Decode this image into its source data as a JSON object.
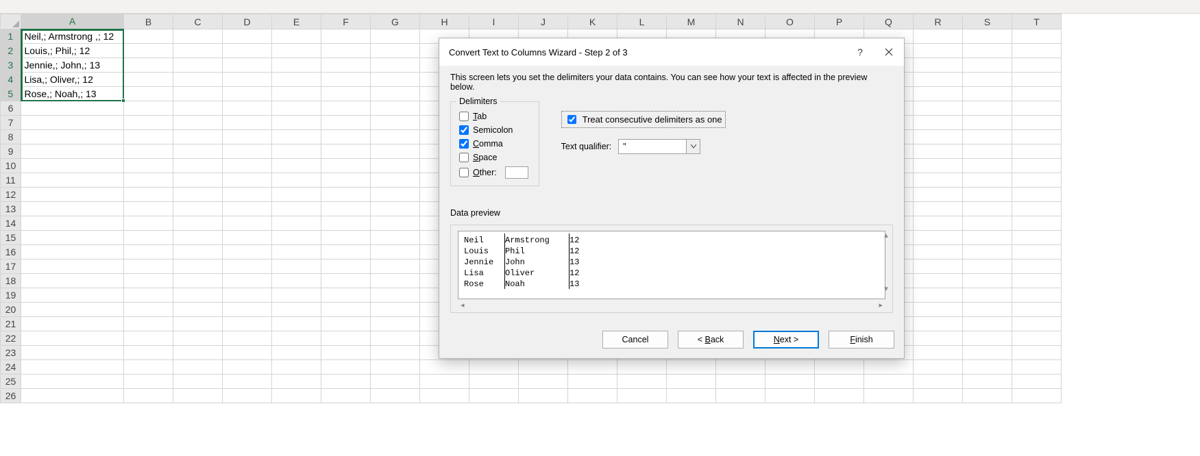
{
  "sheet": {
    "columns": [
      "A",
      "B",
      "C",
      "D",
      "E",
      "F",
      "G",
      "H",
      "I",
      "J",
      "K",
      "L",
      "M",
      "N",
      "O",
      "P",
      "Q",
      "R",
      "S",
      "T"
    ],
    "row_count": 26,
    "selected_col_index": 0,
    "selected_row_start": 1,
    "selected_row_end": 5,
    "cells": {
      "A1": "Neil,; Armstrong ,; 12",
      "A2": "Louis,; Phil,; 12",
      "A3": "Jennie,; John,; 13",
      "A4": "Lisa,; Oliver,; 12",
      "A5": "Rose,; Noah,; 13"
    }
  },
  "dialog": {
    "title": "Convert Text to Columns Wizard - Step 2 of 3",
    "description": "This screen lets you set the delimiters your data contains.  You can see how your text is affected in the preview below.",
    "delimiters_legend": "Delimiters",
    "tab_label": "Tab",
    "semicolon_label": "Semicolon",
    "comma_label": "Comma",
    "space_label": "Space",
    "other_label": "Other:",
    "tab_checked": false,
    "semicolon_checked": true,
    "comma_checked": true,
    "space_checked": false,
    "other_checked": false,
    "other_value": "",
    "treat_label": "Treat consecutive delimiters as one",
    "treat_checked": true,
    "qualifier_label": "Text qualifier:",
    "qualifier_value": "\"",
    "preview_label": "Data preview",
    "preview_rows": [
      [
        "Neil",
        "Armstrong",
        "12"
      ],
      [
        "Louis",
        "Phil",
        "12"
      ],
      [
        "Jennie",
        "John",
        "13"
      ],
      [
        "Lisa",
        "Oliver",
        "12"
      ],
      [
        "Rose",
        "Noah",
        "13"
      ]
    ],
    "buttons": {
      "cancel": "Cancel",
      "back": "< Back",
      "next": "Next >",
      "finish": "Finish"
    }
  }
}
